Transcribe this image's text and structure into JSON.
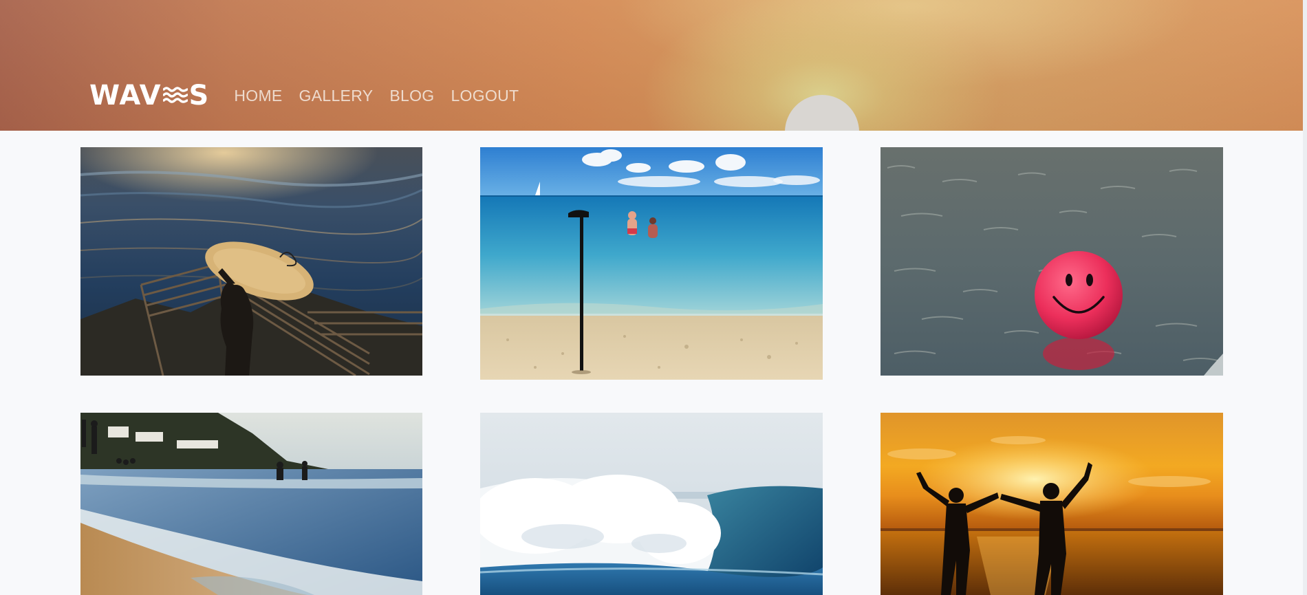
{
  "header": {
    "logo_text_left": "WAV",
    "logo_text_right": "S",
    "nav": [
      {
        "label": "HOME"
      },
      {
        "label": "GALLERY"
      },
      {
        "label": "BLOG"
      },
      {
        "label": "LOGOUT"
      }
    ]
  },
  "gallery": {
    "images": [
      {
        "subject": "surfer carrying surfboard down stairs at sunset sea"
      },
      {
        "subject": "walking cane standing in beach sand, couple wading in sea"
      },
      {
        "subject": "pink smiley face ball floating on water"
      },
      {
        "subject": "beach shoreline with waves and people swimming"
      },
      {
        "subject": "large breaking ocean wave"
      },
      {
        "subject": "two silhouettes holding hands raised at sunset over sea"
      }
    ]
  },
  "colors": {
    "page_background": "#f8f9fb",
    "nav_text": "#f3e6dc",
    "logo": "#ffffff"
  }
}
